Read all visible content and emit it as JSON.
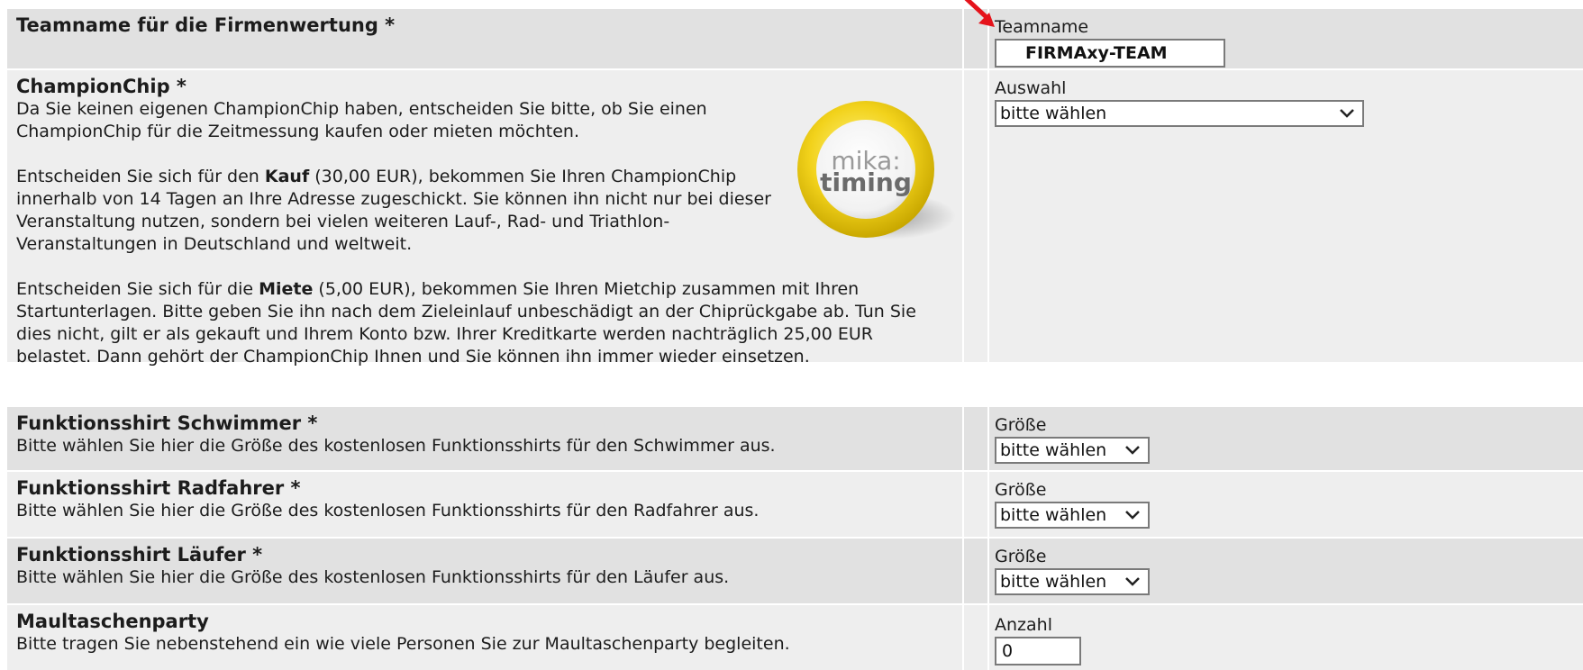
{
  "rows": {
    "team": {
      "title": "Teamname für die Firmenwertung *",
      "field_label": "Teamname",
      "input_value": "FIRMAxy-TEAM"
    },
    "chip": {
      "title": "ChampionChip *",
      "p1": "Da Sie keinen eigenen ChampionChip haben, entscheiden Sie bitte, ob Sie einen ChampionChip für die Zeitmessung kaufen oder mieten möchten.",
      "p2_pre": "Entscheiden Sie sich für den ",
      "p2_bold": "Kauf",
      "p2_post": " (30,00 EUR), bekommen Sie Ihren ChampionChip innerhalb von 14 Tagen an Ihre Adresse zugeschickt. Sie können ihn nicht nur bei dieser Veranstaltung nutzen, sondern bei vielen weiteren Lauf-, Rad- und Triathlon-Veranstaltungen in Deutschland und weltweit.",
      "p3_pre": "Entscheiden Sie sich für die ",
      "p3_bold": "Miete",
      "p3_post": " (5,00 EUR), bekommen Sie Ihren Mietchip zusammen mit Ihren Startunterlagen. Bitte geben Sie ihn nach dem Zieleinlauf unbeschädigt an der Chiprückgabe ab. Tun Sie dies nicht, gilt er als gekauft und Ihrem Konto bzw. Ihrer Kreditkarte werden nachträglich 25,00 EUR belastet. Dann gehört der ChampionChip Ihnen und Sie können ihn immer wieder einsetzen.",
      "logo_line1": "mika:",
      "logo_line2": "timing",
      "field_label": "Auswahl",
      "select_value": "bitte wählen"
    },
    "shirt_swim": {
      "title": "Funktionsshirt Schwimmer *",
      "desc": "Bitte wählen Sie hier die Größe des kostenlosen Funktionsshirts für den Schwimmer aus.",
      "field_label": "Größe",
      "select_value": "bitte wählen"
    },
    "shirt_bike": {
      "title": "Funktionsshirt Radfahrer *",
      "desc": "Bitte wählen Sie hier die Größe des kostenlosen Funktionsshirts für den Radfahrer aus.",
      "field_label": "Größe",
      "select_value": "bitte wählen"
    },
    "shirt_run": {
      "title": "Funktionsshirt Läufer *",
      "desc": "Bitte wählen Sie hier die Größe des kostenlosen Funktionsshirts für den Läufer aus.",
      "field_label": "Größe",
      "select_value": "bitte wählen"
    },
    "party": {
      "title": "Maultaschenparty",
      "desc": "Bitte tragen Sie nebenstehend ein wie viele Personen Sie zur Maultaschenparty begleiten.",
      "field_label": "Anzahl",
      "input_value": "0"
    }
  },
  "colors": {
    "row_dark": "#e1e1e1",
    "row_light": "#eeeeee",
    "annotation_arrow": "#e5131b",
    "chip_yellow": "#f2d21b"
  },
  "icons": {
    "annotation": "red-arrow-icon",
    "select": "chevron-down-icon",
    "logo": "mika-timing-chip-logo"
  }
}
